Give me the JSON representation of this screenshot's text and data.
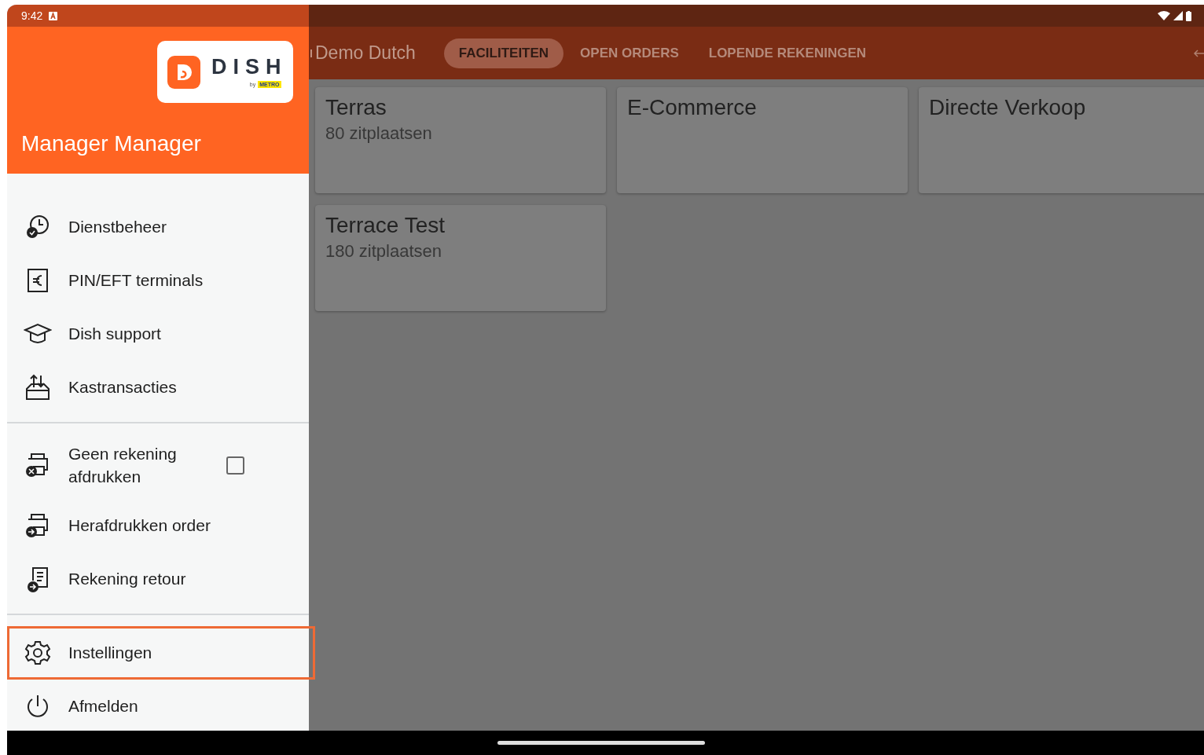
{
  "status_bar": {
    "time": "9:42"
  },
  "drawer": {
    "logo": {
      "name": "DISH",
      "by": "by",
      "brand": "METRO"
    },
    "user": "Manager Manager",
    "groups": [
      {
        "items": [
          {
            "kind": "link",
            "label": "Dienstbeheer",
            "selected": false
          },
          {
            "kind": "link",
            "label": "PIN/EFT terminals",
            "selected": false
          },
          {
            "kind": "link",
            "label": "Dish support",
            "selected": false
          },
          {
            "kind": "link",
            "label": "Kastransacties",
            "selected": false
          }
        ]
      },
      {
        "items": [
          {
            "kind": "checkbox",
            "label": "Geen rekening afdrukken",
            "checked": false,
            "selected": false
          },
          {
            "kind": "link",
            "label": "Herafdrukken order",
            "selected": false
          },
          {
            "kind": "link",
            "label": "Rekening retour",
            "selected": false
          }
        ]
      },
      {
        "items": [
          {
            "kind": "link",
            "label": "Instellingen",
            "selected": true
          },
          {
            "kind": "link",
            "label": "Afmelden",
            "selected": false
          }
        ]
      }
    ]
  },
  "app_bar": {
    "title": "Demo Dutch",
    "tabs": [
      {
        "label": "FACILITEITEN",
        "selected": true
      },
      {
        "label": "OPEN ORDERS",
        "selected": false
      },
      {
        "label": "LOPENDE REKENINGEN",
        "selected": false
      }
    ]
  },
  "facilities": [
    {
      "name": "Terras",
      "seats": "80 zitplaatsen"
    },
    {
      "name": "E-Commerce"
    },
    {
      "name": "Directe Verkoop"
    },
    {
      "name": "Terrace Test",
      "seats": "180 zitplaatsen"
    }
  ]
}
